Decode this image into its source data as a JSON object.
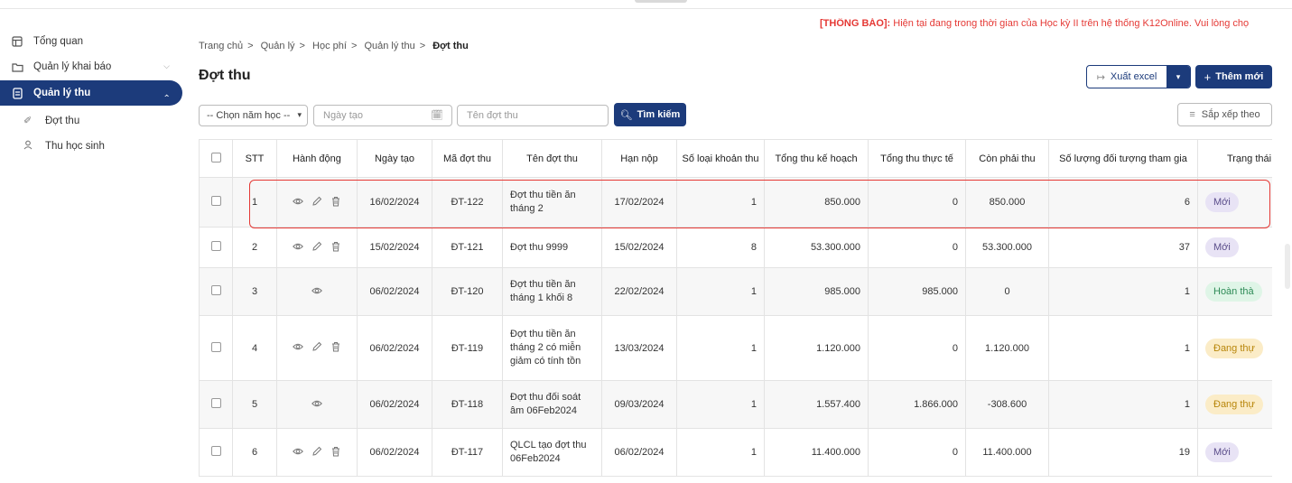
{
  "sidebar": {
    "items": [
      {
        "label": "Tổng quan"
      },
      {
        "label": "Quản lý khai báo"
      },
      {
        "label": "Quản lý thu"
      }
    ],
    "subitems": [
      {
        "label": "Đợt thu"
      },
      {
        "label": "Thu học sinh"
      }
    ]
  },
  "notice": {
    "tag": "[THÔNG BÁO]:",
    "text": " Hiện tại đang trong thời gian của Học kỳ II trên hệ thống K12Online. Vui lòng chọ"
  },
  "breadcrumb": [
    "Trang chủ",
    "Quản lý",
    "Học phí",
    "Quản lý thu",
    "Đợt thu"
  ],
  "page": {
    "title": "Đợt thu",
    "export_label": "Xuất excel",
    "add_label": "Thêm mới"
  },
  "filters": {
    "year_select": "-- Chọn năm học --",
    "date_placeholder": "Ngày tạo",
    "name_placeholder": "Tên đợt thu",
    "search_label": "Tìm kiếm",
    "sort_label": "Sắp xếp theo"
  },
  "table": {
    "headers": [
      "STT",
      "Hành động",
      "Ngày tạo",
      "Mã đợt thu",
      "Tên đợt thu",
      "Hạn nộp",
      "Số loại khoản thu",
      "Tổng thu kế hoạch",
      "Tổng thu thực tế",
      "Còn phải thu",
      "Số lượng đối tượng tham gia",
      "Trạng thái"
    ],
    "rows": [
      {
        "stt": "1",
        "date": "16/02/2024",
        "code": "ĐT-122",
        "name": "Đợt thu tiền ăn tháng 2",
        "due": "17/02/2024",
        "types": "1",
        "plan": "850.000",
        "actual": "0",
        "remaining": "850.000",
        "count": "6",
        "status": "Mới"
      },
      {
        "stt": "2",
        "date": "15/02/2024",
        "code": "ĐT-121",
        "name": "Đợt thu 9999",
        "due": "15/02/2024",
        "types": "8",
        "plan": "53.300.000",
        "actual": "0",
        "remaining": "53.300.000",
        "count": "37",
        "status": "Mới"
      },
      {
        "stt": "3",
        "date": "06/02/2024",
        "code": "ĐT-120",
        "name": "Đợt thu tiền ăn tháng 1 khối 8",
        "due": "22/02/2024",
        "types": "1",
        "plan": "985.000",
        "actual": "985.000",
        "remaining": "0",
        "count": "1",
        "status": "Hoàn thà"
      },
      {
        "stt": "4",
        "date": "06/02/2024",
        "code": "ĐT-119",
        "name": "Đợt thu tiền ăn tháng 2 có miễn giảm có tính tồn",
        "due": "13/03/2024",
        "types": "1",
        "plan": "1.120.000",
        "actual": "0",
        "remaining": "1.120.000",
        "count": "1",
        "status": "Đang thự"
      },
      {
        "stt": "5",
        "date": "06/02/2024",
        "code": "ĐT-118",
        "name": "Đợt thu đối soát âm 06Feb2024",
        "due": "09/03/2024",
        "types": "1",
        "plan": "1.557.400",
        "actual": "1.866.000",
        "remaining": "-308.600",
        "count": "1",
        "status": "Đang thự"
      },
      {
        "stt": "6",
        "date": "06/02/2024",
        "code": "ĐT-117",
        "name": "QLCL tạo đợt thu 06Feb2024",
        "due": "06/02/2024",
        "types": "1",
        "plan": "11.400.000",
        "actual": "0",
        "remaining": "11.400.000",
        "count": "19",
        "status": "Mới"
      }
    ]
  },
  "colors": {
    "primary": "#1c3b7b",
    "notice": "#e53935",
    "highlight": "#e53935"
  }
}
